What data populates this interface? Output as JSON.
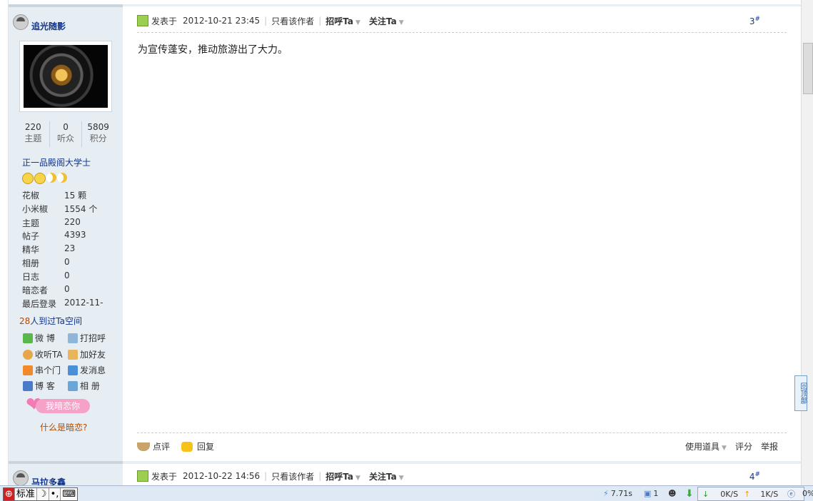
{
  "post1": {
    "author": "追光随影",
    "stats": [
      {
        "value": "220",
        "label": "主题"
      },
      {
        "value": "0",
        "label": "听众"
      },
      {
        "value": "5809",
        "label": "积分"
      }
    ],
    "rank": "正一品殿阁大学士",
    "profile": [
      {
        "key": "花椒",
        "value": "15 颗"
      },
      {
        "key": "小米椒",
        "value": "1554 个"
      },
      {
        "key": "主题",
        "value": "220"
      },
      {
        "key": "帖子",
        "value": "4393"
      },
      {
        "key": "精华",
        "value": "23"
      },
      {
        "key": "相册",
        "value": "0"
      },
      {
        "key": "日志",
        "value": "0"
      },
      {
        "key": "暗恋者",
        "value": "0"
      },
      {
        "key": "最后登录",
        "value": "2012-11-"
      }
    ],
    "visitors_count": "28",
    "visitors_text": "人到过Ta空间",
    "actions": {
      "weibo": "微 博",
      "greet": "打招呼",
      "follow": "收听TA",
      "add_friend": "加好友",
      "visit": "串个门",
      "message": "发消息",
      "blog": "博 客",
      "album": "相 册"
    },
    "crush_button": "我暗恋你",
    "crush_link": "什么是暗恋?",
    "posted_label": "发表于",
    "posted_time": "2012-10-21 23:45",
    "only_author": "只看该作者",
    "greet_ta": "招呼Ta",
    "follow_ta": "关注Ta",
    "floor": "3",
    "floor_mark": "#",
    "content": "为宣传蓬安，推动旅游出了大力。",
    "footer": {
      "comment": "点评",
      "reply": "回复",
      "use_tool": "使用道具",
      "rate": "评分",
      "report": "举报"
    }
  },
  "post2": {
    "author": "马拉多鑫",
    "posted_label": "发表于",
    "posted_time": "2012-10-22 14:56",
    "only_author": "只看该作者",
    "greet_ta": "招呼Ta",
    "follow_ta": "关注Ta",
    "floor": "4",
    "floor_mark": "#"
  },
  "back_to_top": "回顶部",
  "taskbar": {
    "ime_mode": "标准",
    "load_time": "7.71s",
    "count": "1",
    "down_speed": "0K/S",
    "up_speed": "1K/S",
    "percent": "0%"
  }
}
